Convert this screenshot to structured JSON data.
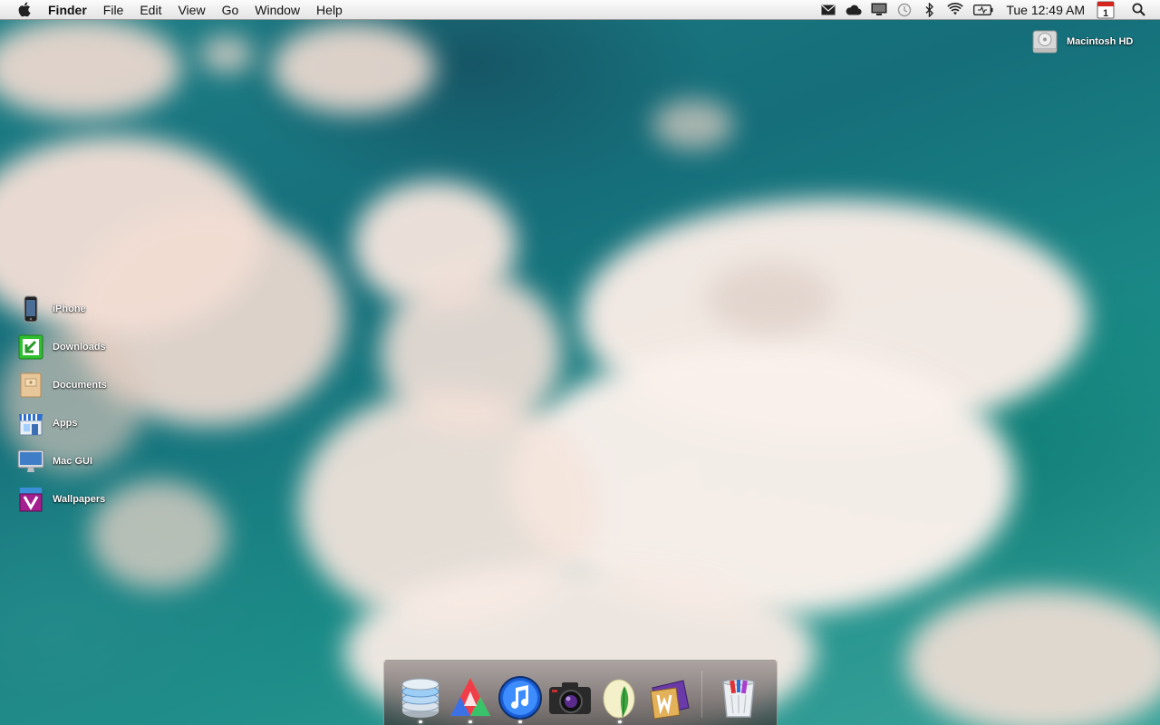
{
  "menubar": {
    "app_name": "Finder",
    "items": [
      "File",
      "Edit",
      "View",
      "Go",
      "Window",
      "Help"
    ],
    "status_icons": [
      "mail-icon",
      "cloud-icon",
      "display-icon",
      "time-machine-icon",
      "bluetooth-icon",
      "wifi-icon",
      "battery-icon"
    ],
    "clock": "Tue 12:49 AM",
    "calendar_day": "1"
  },
  "desktop": {
    "drive": {
      "label": "Macintosh HD",
      "icon": "hard-drive-icon"
    },
    "items": [
      {
        "label": "iPhone",
        "icon": "iphone-icon"
      },
      {
        "label": "Downloads",
        "icon": "downloads-folder-icon"
      },
      {
        "label": "Documents",
        "icon": "documents-folder-icon"
      },
      {
        "label": "Apps",
        "icon": "apps-store-icon"
      },
      {
        "label": "Mac GUI",
        "icon": "imac-icon"
      },
      {
        "label": "Wallpapers",
        "icon": "wallpapers-icon"
      }
    ]
  },
  "dock": {
    "apps": [
      {
        "icon": "stack-app-icon",
        "running": true
      },
      {
        "icon": "color-prism-app-icon",
        "running": true
      },
      {
        "icon": "itunes-app-icon",
        "running": true
      },
      {
        "icon": "camera-app-icon",
        "running": false
      },
      {
        "icon": "feather-egg-app-icon",
        "running": true
      },
      {
        "icon": "wunderkit-app-icon",
        "running": false
      }
    ],
    "trash_icon": "trash-icon"
  }
}
